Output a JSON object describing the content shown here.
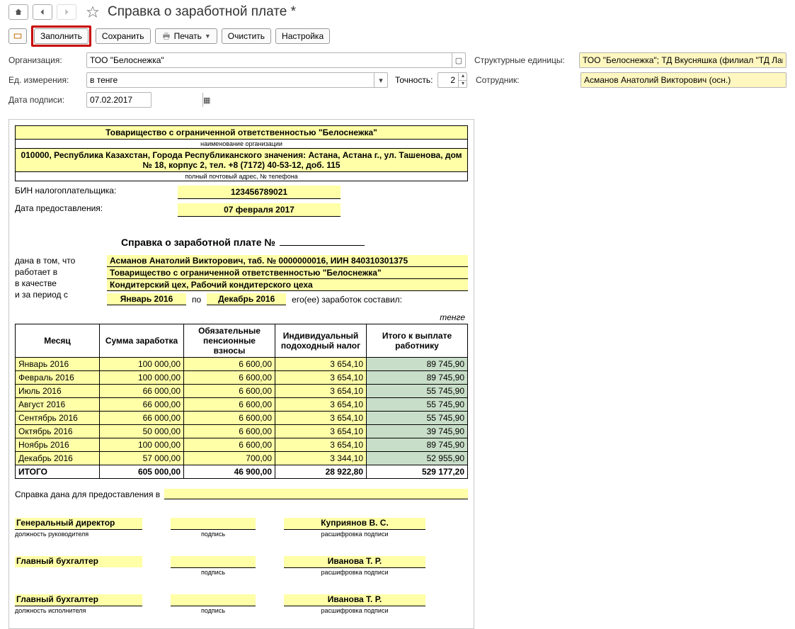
{
  "window": {
    "title": "Справка о заработной плате *"
  },
  "toolbar": {
    "fill": "Заполнить",
    "save": "Сохранить",
    "print": "Печать",
    "clear": "Очистить",
    "settings": "Настройка"
  },
  "form": {
    "org_label": "Организация:",
    "org_value": "ТОО \"Белоснежка\"",
    "units_label": "Структурные единицы:",
    "units_value": "ТОО \"Белоснежка\"; ТД Вкусняшка (филиал \"ТД Лакомка\")",
    "measure_label": "Ед. измерения:",
    "measure_value": "в тенге",
    "precision_label": "Точность:",
    "precision_value": "2",
    "employee_label": "Сотрудник:",
    "employee_value": "Асманов Анатолий Викторович (осн.)",
    "sign_date_label": "Дата подписи:",
    "sign_date_value": "07.02.2017"
  },
  "doc": {
    "org_name": "Товарищество с ограниченной ответственностью \"Белоснежка\"",
    "org_name_caption": "наименование организации",
    "org_address": "010000, Республика Казахстан, Города Республиканского значения: Астана, Астана г., ул. Ташенова, дом № 18, корпус 2, тел. +8 (7172) 40-53-12, доб. 115",
    "org_address_caption": "полный почтовый адрес, № телефона",
    "bin_label": "БИН налогоплательщика:",
    "bin_value": "123456789021",
    "issue_date_label": "Дата предоставления:",
    "issue_date_value": "07 февраля 2017",
    "title": "Справка о заработной плате №",
    "given_text": "дана в том, что\nработает в\nв качестве\nи за период с",
    "employee_line": "Асманов Анатолий Викторович, таб. № 0000000016, ИИН 840310301375",
    "works_at": "Товарищество с ограниченной ответственностью \"Белоснежка\"",
    "position": "Кондитерский цех, Рабочий кондитерского цеха",
    "period_from": "Январь 2016",
    "period_sep": "по",
    "period_to": "Декабрь 2016",
    "period_tail": "его(ее) заработок составил:",
    "unit_note": "тенге",
    "given_for_label": "Справка дана для предоставления в",
    "columns": {
      "month": "Месяц",
      "earning": "Сумма заработка",
      "pension": "Обязательные пенсионные взносы",
      "tax": "Индивидуальный подоходный налог",
      "payout": "Итого к выплате работнику"
    },
    "rows": [
      {
        "month": "Январь 2016",
        "earning": "100 000,00",
        "pension": "6 600,00",
        "tax": "3 654,10",
        "payout": "89 745,90"
      },
      {
        "month": "Февраль 2016",
        "earning": "100 000,00",
        "pension": "6 600,00",
        "tax": "3 654,10",
        "payout": "89 745,90"
      },
      {
        "month": "Июль 2016",
        "earning": "66 000,00",
        "pension": "6 600,00",
        "tax": "3 654,10",
        "payout": "55 745,90"
      },
      {
        "month": "Август 2016",
        "earning": "66 000,00",
        "pension": "6 600,00",
        "tax": "3 654,10",
        "payout": "55 745,90"
      },
      {
        "month": "Сентябрь 2016",
        "earning": "66 000,00",
        "pension": "6 600,00",
        "tax": "3 654,10",
        "payout": "55 745,90"
      },
      {
        "month": "Октябрь 2016",
        "earning": "50 000,00",
        "pension": "6 600,00",
        "tax": "3 654,10",
        "payout": "39 745,90"
      },
      {
        "month": "Ноябрь 2016",
        "earning": "100 000,00",
        "pension": "6 600,00",
        "tax": "3 654,10",
        "payout": "89 745,90"
      },
      {
        "month": "Декабрь 2016",
        "earning": "57 000,00",
        "pension": "700,00",
        "tax": "3 344,10",
        "payout": "52 955,90"
      }
    ],
    "total": {
      "label": "ИТОГО",
      "earning": "605 000,00",
      "pension": "46 900,00",
      "tax": "28 922,80",
      "payout": "529 177,20"
    },
    "sign": {
      "role1": "Генеральный директор",
      "role1_cap": "должность руководителя",
      "role2": "Главный бухгалтер",
      "role3": "Главный бухгалтер",
      "role3_cap": "должность исполнителя",
      "sign_cap": "подпись",
      "name1": "Куприянов В. С.",
      "name_cap": "расшифровка подписи",
      "name2": "Иванова Т. Р.",
      "name3": "Иванова Т. Р."
    }
  }
}
